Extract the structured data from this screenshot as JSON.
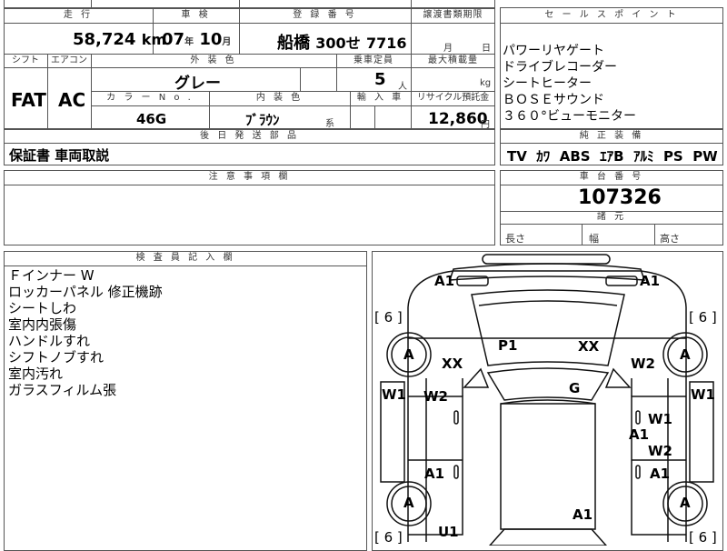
{
  "sheet": {
    "headers": {
      "mileage": "走 行",
      "inspection": "車 検",
      "registration": "登 録 番 号",
      "transfer_deadline": "譲渡書類期限",
      "shift": "シフト",
      "aircon": "エアコン",
      "exterior_color": "外 装 色",
      "capacity": "乗車定員",
      "max_load": "最大積載量",
      "color_no": "カ ラ ー N o .",
      "interior_color": "内 装 色",
      "import": "輸 入 車",
      "recycle": "リサイクル預託金",
      "later_parts": "後 日 発 送 部 品",
      "cautions": "注 意 事 項 欄",
      "inspector": "検 査 員 記 入 欄",
      "sales_points": "セ ー ル ス ポ イ ン ト",
      "equipment": "純 正 装 備",
      "chassis_no": "車 台 番 号",
      "dimensions": "諸 元"
    },
    "mileage": {
      "value": "58,724",
      "unit": "km"
    },
    "inspection": {
      "year": "07",
      "year_unit": "年",
      "month": "10",
      "month_unit": "月"
    },
    "registration": {
      "area": "船橋",
      "class": "300",
      "kana": "せ",
      "number": "7716"
    },
    "transfer_deadline": {
      "month_unit": "月",
      "day_unit": "日"
    },
    "shift": "FAT",
    "aircon": "AC",
    "exterior_color": "グレー",
    "capacity": {
      "value": "5",
      "unit": "人"
    },
    "max_load": {
      "unit": "kg"
    },
    "color_no": "46G",
    "interior_color": {
      "value": "ﾌﾞﾗｳﾝ",
      "suffix": "系"
    },
    "recycle": {
      "value": "12,860",
      "unit": "円"
    },
    "later_parts": "保証書 車両取説",
    "inspector_notes": [
      "Ｆインナー W",
      "ロッカーパネル 修正機跡",
      "シートしわ",
      "室内内張傷",
      "ハンドルすれ",
      "シフトノブすれ",
      "室内汚れ",
      "ガラスフィルム張"
    ],
    "sales_points": [
      "パワーリヤゲート",
      "ドライブレコーダー",
      "シートヒーター",
      "ＢＯＳＥサウンド",
      "３６０°ビューモニター"
    ],
    "equipment": [
      "TV",
      "ｶﾜ",
      "ABS",
      "ｴｱB",
      "ｱﾙﾐ",
      "PS",
      "PW"
    ],
    "chassis_no": "107326",
    "dimensions": {
      "length": "長さ",
      "width": "幅",
      "height": "高さ"
    }
  },
  "diagram": {
    "tire_label": "[ 6 ]",
    "wheel_label": "A",
    "tread": "6",
    "marks": {
      "a1_tl": "A1",
      "a1_tr": "A1",
      "p1": "P1",
      "xx_top": "XX",
      "xx_left": "XX",
      "w2_right": "W2",
      "g": "G",
      "w1_left": "W1",
      "w1_right": "W1",
      "w2_left": "W2",
      "w1_rd": "W1",
      "a1_rd": "A1",
      "w2_rd2": "W2",
      "a1_ld": "A1",
      "a1_rd2": "A1",
      "a1_bottom": "A1",
      "u1": "U1"
    }
  }
}
